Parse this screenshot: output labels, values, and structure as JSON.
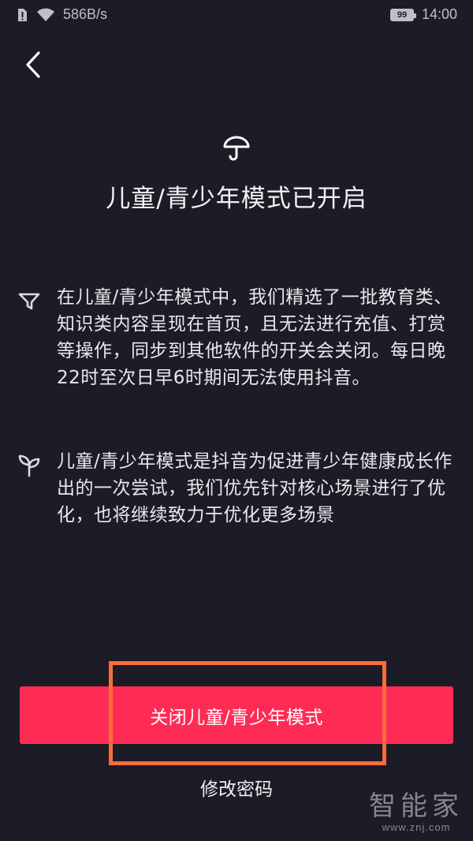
{
  "status_bar": {
    "network_speed": "586B/s",
    "battery_level": "99",
    "time": "14:00"
  },
  "page": {
    "title": "儿童/青少年模式已开启"
  },
  "info": [
    {
      "icon": "filter-funnel-icon",
      "text": "在儿童/青少年模式中，我们精选了一批教育类、知识类内容呈现在首页，且无法进行充值、打赏等操作，同步到其他软件的开关会关闭。每日晚22时至次日早6时期间无法使用抖音。"
    },
    {
      "icon": "sprout-icon",
      "text": "儿童/青少年模式是抖音为促进青少年健康成长作出的一次尝试，我们优先针对核心场景进行了优化，也将继续致力于优化更多场景"
    }
  ],
  "actions": {
    "close_mode_label": "关闭儿童/青少年模式",
    "change_password_label": "修改密码"
  },
  "watermark": {
    "main": "智能家",
    "url": "www.znj.com"
  },
  "colors": {
    "background": "#1b1c26",
    "primary_button": "#fe2c55",
    "highlight_frame": "#ff6b3d"
  }
}
